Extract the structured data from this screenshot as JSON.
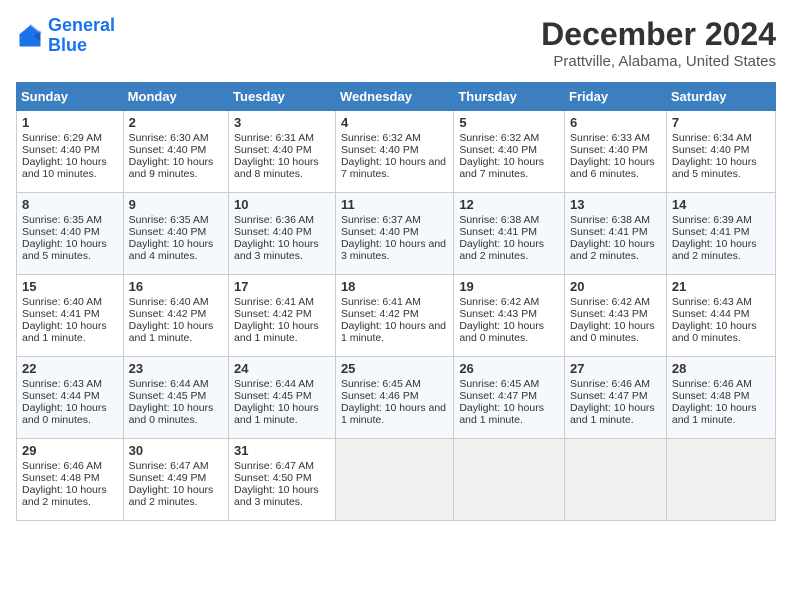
{
  "logo": {
    "line1": "General",
    "line2": "Blue"
  },
  "title": "December 2024",
  "subtitle": "Prattville, Alabama, United States",
  "days_of_week": [
    "Sunday",
    "Monday",
    "Tuesday",
    "Wednesday",
    "Thursday",
    "Friday",
    "Saturday"
  ],
  "weeks": [
    [
      {
        "day": 1,
        "sunrise": "6:29 AM",
        "sunset": "4:40 PM",
        "daylight": "10 hours and 10 minutes."
      },
      {
        "day": 2,
        "sunrise": "6:30 AM",
        "sunset": "4:40 PM",
        "daylight": "10 hours and 9 minutes."
      },
      {
        "day": 3,
        "sunrise": "6:31 AM",
        "sunset": "4:40 PM",
        "daylight": "10 hours and 8 minutes."
      },
      {
        "day": 4,
        "sunrise": "6:32 AM",
        "sunset": "4:40 PM",
        "daylight": "10 hours and 7 minutes."
      },
      {
        "day": 5,
        "sunrise": "6:32 AM",
        "sunset": "4:40 PM",
        "daylight": "10 hours and 7 minutes."
      },
      {
        "day": 6,
        "sunrise": "6:33 AM",
        "sunset": "4:40 PM",
        "daylight": "10 hours and 6 minutes."
      },
      {
        "day": 7,
        "sunrise": "6:34 AM",
        "sunset": "4:40 PM",
        "daylight": "10 hours and 5 minutes."
      }
    ],
    [
      {
        "day": 8,
        "sunrise": "6:35 AM",
        "sunset": "4:40 PM",
        "daylight": "10 hours and 5 minutes."
      },
      {
        "day": 9,
        "sunrise": "6:35 AM",
        "sunset": "4:40 PM",
        "daylight": "10 hours and 4 minutes."
      },
      {
        "day": 10,
        "sunrise": "6:36 AM",
        "sunset": "4:40 PM",
        "daylight": "10 hours and 3 minutes."
      },
      {
        "day": 11,
        "sunrise": "6:37 AM",
        "sunset": "4:40 PM",
        "daylight": "10 hours and 3 minutes."
      },
      {
        "day": 12,
        "sunrise": "6:38 AM",
        "sunset": "4:41 PM",
        "daylight": "10 hours and 2 minutes."
      },
      {
        "day": 13,
        "sunrise": "6:38 AM",
        "sunset": "4:41 PM",
        "daylight": "10 hours and 2 minutes."
      },
      {
        "day": 14,
        "sunrise": "6:39 AM",
        "sunset": "4:41 PM",
        "daylight": "10 hours and 2 minutes."
      }
    ],
    [
      {
        "day": 15,
        "sunrise": "6:40 AM",
        "sunset": "4:41 PM",
        "daylight": "10 hours and 1 minute."
      },
      {
        "day": 16,
        "sunrise": "6:40 AM",
        "sunset": "4:42 PM",
        "daylight": "10 hours and 1 minute."
      },
      {
        "day": 17,
        "sunrise": "6:41 AM",
        "sunset": "4:42 PM",
        "daylight": "10 hours and 1 minute."
      },
      {
        "day": 18,
        "sunrise": "6:41 AM",
        "sunset": "4:42 PM",
        "daylight": "10 hours and 1 minute."
      },
      {
        "day": 19,
        "sunrise": "6:42 AM",
        "sunset": "4:43 PM",
        "daylight": "10 hours and 0 minutes."
      },
      {
        "day": 20,
        "sunrise": "6:42 AM",
        "sunset": "4:43 PM",
        "daylight": "10 hours and 0 minutes."
      },
      {
        "day": 21,
        "sunrise": "6:43 AM",
        "sunset": "4:44 PM",
        "daylight": "10 hours and 0 minutes."
      }
    ],
    [
      {
        "day": 22,
        "sunrise": "6:43 AM",
        "sunset": "4:44 PM",
        "daylight": "10 hours and 0 minutes."
      },
      {
        "day": 23,
        "sunrise": "6:44 AM",
        "sunset": "4:45 PM",
        "daylight": "10 hours and 0 minutes."
      },
      {
        "day": 24,
        "sunrise": "6:44 AM",
        "sunset": "4:45 PM",
        "daylight": "10 hours and 1 minute."
      },
      {
        "day": 25,
        "sunrise": "6:45 AM",
        "sunset": "4:46 PM",
        "daylight": "10 hours and 1 minute."
      },
      {
        "day": 26,
        "sunrise": "6:45 AM",
        "sunset": "4:47 PM",
        "daylight": "10 hours and 1 minute."
      },
      {
        "day": 27,
        "sunrise": "6:46 AM",
        "sunset": "4:47 PM",
        "daylight": "10 hours and 1 minute."
      },
      {
        "day": 28,
        "sunrise": "6:46 AM",
        "sunset": "4:48 PM",
        "daylight": "10 hours and 1 minute."
      }
    ],
    [
      {
        "day": 29,
        "sunrise": "6:46 AM",
        "sunset": "4:48 PM",
        "daylight": "10 hours and 2 minutes."
      },
      {
        "day": 30,
        "sunrise": "6:47 AM",
        "sunset": "4:49 PM",
        "daylight": "10 hours and 2 minutes."
      },
      {
        "day": 31,
        "sunrise": "6:47 AM",
        "sunset": "4:50 PM",
        "daylight": "10 hours and 3 minutes."
      },
      null,
      null,
      null,
      null
    ]
  ]
}
